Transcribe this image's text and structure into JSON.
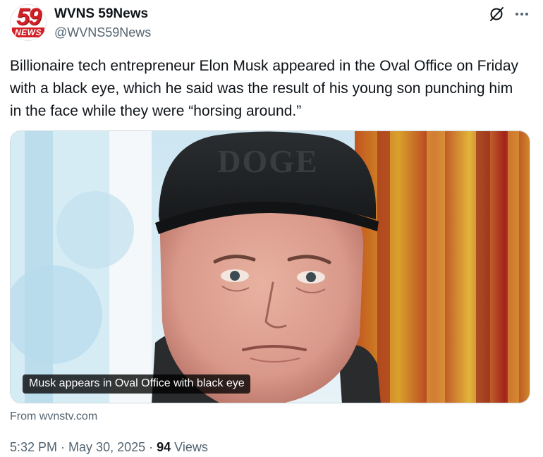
{
  "account": {
    "name": "WVNS 59News",
    "handle": "@WVNS59News",
    "avatar_text_top": "59",
    "avatar_text_bottom": "NEWS",
    "avatar_color": "#d32027"
  },
  "icons": {
    "grok": "grok-slash-icon",
    "more": "more-horizontal-icon"
  },
  "tweet": {
    "text": "Billionaire tech entrepreneur Elon Musk appeared in the Oval Office on Friday with a black eye, which he said was the result of his young son punching him in the face while they were “horsing around.”"
  },
  "media": {
    "cap_text": "DOGE",
    "caption": "Musk appears in Oval Office with black eye"
  },
  "link_card": {
    "source": "From wvnstv.com"
  },
  "meta": {
    "time": "5:32 PM",
    "separator1": " · ",
    "date": "May 30, 2025",
    "separator2": " · ",
    "views_count": "94",
    "views_label": " Views"
  }
}
